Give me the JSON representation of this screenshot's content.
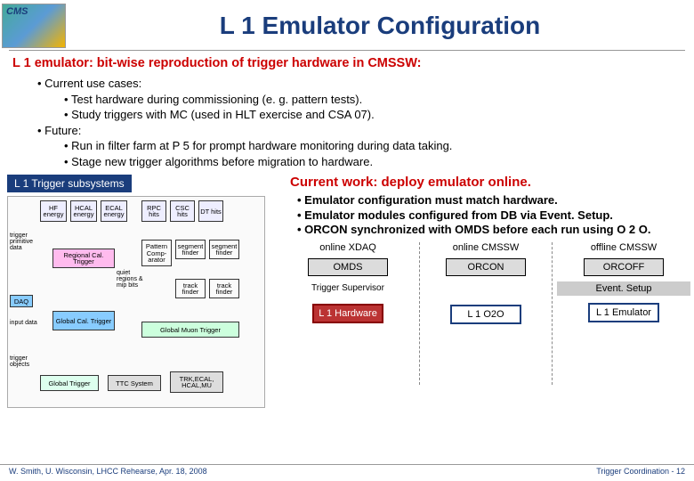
{
  "header": {
    "title": "L 1 Emulator Configuration",
    "logo_label": "CMS"
  },
  "subtitle": "L 1 emulator: bit-wise reproduction of trigger hardware in CMSSW:",
  "bullets": {
    "b1": "Current use cases:",
    "b1a": "Test hardware during commissioning (e. g. pattern tests).",
    "b1b": "Study triggers with MC (used in HLT exercise and CSA 07).",
    "b2": "Future:",
    "b2a": "Run in filter farm at P 5 for prompt hardware monitoring during data taking.",
    "b2b": "Stage new trigger algorithms before migration to hardware."
  },
  "leftBanner": "L 1 Trigger subsystems",
  "diagram": {
    "hf": "HF energy",
    "hcal": "HCAL energy",
    "ecal": "ECAL energy",
    "rpc": "RPC hits",
    "csc": "CSC hits",
    "dt": "DT hits",
    "rct": "Regional Cal. Trigger",
    "patcomp": "Pattern Comp- arator",
    "segf1": "segment finder",
    "segf2": "segment finder",
    "trkf1": "track finder",
    "trkf2": "track finder",
    "gct": "Global Cal. Trigger",
    "gmt": "Global Muon Trigger",
    "gt": "Global Trigger",
    "ttc": "TTC System",
    "trk": "TRK,ECAL, HCAL,MU",
    "daq": "DAQ",
    "lab1": "trigger primitive data",
    "lab2": "input data",
    "lab3": "trigger objects",
    "lab4": "quiet regions & mip bits"
  },
  "current_work": {
    "title": "Current work: deploy emulator online.",
    "p1": "Emulator configuration must match hardware.",
    "p2": "Emulator modules configured from DB via Event. Setup.",
    "p3": "ORCON synchronized with OMDS before each run using O 2 O."
  },
  "flow": {
    "col1": "online XDAQ",
    "col2": "online CMSSW",
    "col3": "offline CMSSW",
    "omds": "OMDS",
    "trigsup": "Trigger Supervisor",
    "l1hw": "L 1 Hardware",
    "orcon": "ORCON",
    "l1o2o": "L 1 O2O",
    "orcoff": "ORCOFF",
    "evsetup": "Event. Setup",
    "l1emu": "L 1 Emulator"
  },
  "footer": {
    "left": "W. Smith, U. Wisconsin,  LHCC Rehearse, Apr. 18, 2008",
    "right": "Trigger Coordination - ",
    "page": "12"
  }
}
